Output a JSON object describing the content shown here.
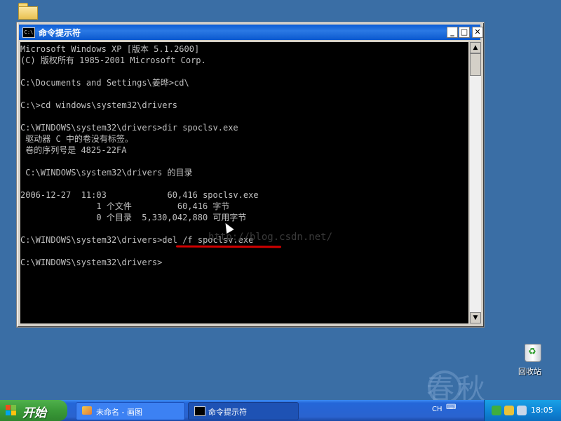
{
  "desktop": {
    "icons": [
      {
        "label": "回收站",
        "icon": "recycle-bin-icon"
      }
    ],
    "watermark": "春秋"
  },
  "window": {
    "title": "命令提示符",
    "icon": "cmd-icon",
    "buttons": {
      "minimize": "_",
      "maximize": "□",
      "close": "✕"
    }
  },
  "console": {
    "lines": [
      "Microsoft Windows XP [版本 5.1.2600]",
      "(C) 版权所有 1985-2001 Microsoft Corp.",
      "",
      "C:\\Documents and Settings\\姜晔>cd\\",
      "",
      "C:\\>cd windows\\system32\\drivers",
      "",
      "C:\\WINDOWS\\system32\\drivers>dir spoclsv.exe",
      " 驱动器 C 中的卷没有标签。",
      " 卷的序列号是 4825-22FA",
      "",
      " C:\\WINDOWS\\system32\\drivers 的目录",
      "",
      "2006-12-27  11:03            60,416 spoclsv.exe",
      "               1 个文件         60,416 字节",
      "               0 个目录  5,330,042,880 可用字节",
      "",
      "C:\\WINDOWS\\system32\\drivers>del /f spoclsv.exe",
      "",
      "C:\\WINDOWS\\system32\\drivers>"
    ],
    "overlay_text": "http://blog.csdn.net/",
    "highlight_color": "#d00000"
  },
  "taskbar": {
    "start_label": "开始",
    "tasks": [
      {
        "label": "未命名 - 画图",
        "icon": "paint-icon"
      },
      {
        "label": "命令提示符",
        "icon": "cmd-icon"
      }
    ],
    "language": "CH",
    "clock": "18:05"
  },
  "colors": {
    "desktop": "#3a6ea5",
    "titlebar": "#0a5bd5",
    "console_bg": "#000000",
    "console_text": "#c0c0c0",
    "start_button": "#3a9a38"
  }
}
